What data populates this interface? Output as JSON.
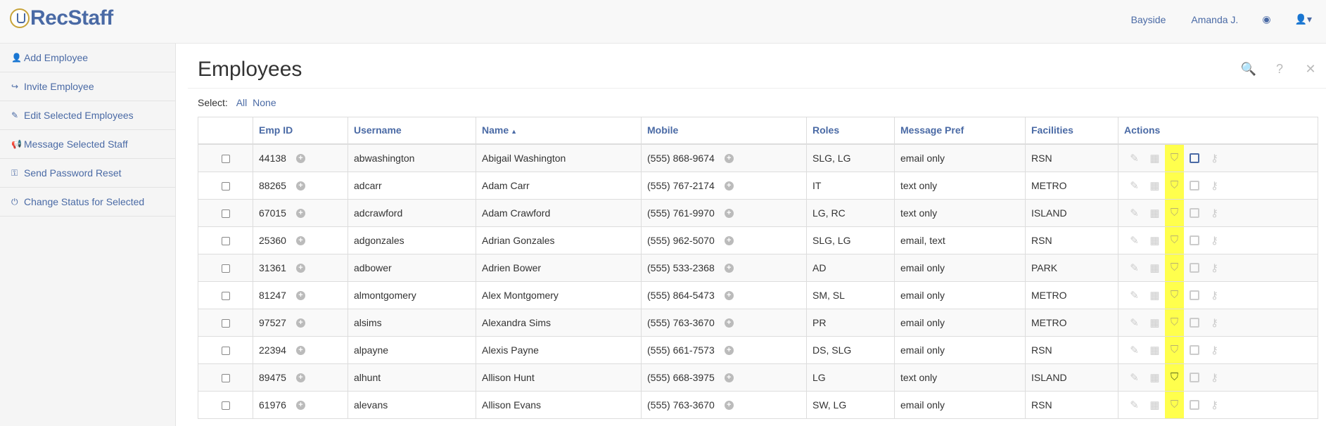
{
  "app": {
    "logo_text": "RecStaff"
  },
  "topnav": {
    "location": "Bayside",
    "user": "Amanda J."
  },
  "sidebar": {
    "items": [
      {
        "label": "Add Employee",
        "icon": "add-user-icon"
      },
      {
        "label": "Invite Employee",
        "icon": "invite-icon"
      },
      {
        "label": "Edit Selected Employees",
        "icon": "edit-icon"
      },
      {
        "label": "Message Selected Staff",
        "icon": "megaphone-icon"
      },
      {
        "label": "Send Password Reset",
        "icon": "key-icon"
      },
      {
        "label": "Change Status for Selected",
        "icon": "power-icon"
      }
    ]
  },
  "page": {
    "title": "Employees",
    "select_label": "Select:",
    "select_all": "All",
    "select_none": "None"
  },
  "table": {
    "columns": [
      "Emp ID",
      "Username",
      "Name",
      "Mobile",
      "Roles",
      "Message Pref",
      "Facilities",
      "Actions"
    ],
    "rows": [
      {
        "emp_id": "44138",
        "username": "abwashington",
        "name": "Abigail Washington",
        "mobile": "(555) 868-9674",
        "roles": "SLG, LG",
        "msg": "email only",
        "facility": "RSN"
      },
      {
        "emp_id": "88265",
        "username": "adcarr",
        "name": "Adam Carr",
        "mobile": "(555) 767-2174",
        "roles": "IT",
        "msg": "text only",
        "facility": "METRO"
      },
      {
        "emp_id": "67015",
        "username": "adcrawford",
        "name": "Adam Crawford",
        "mobile": "(555) 761-9970",
        "roles": "LG, RC",
        "msg": "text only",
        "facility": "ISLAND"
      },
      {
        "emp_id": "25360",
        "username": "adgonzales",
        "name": "Adrian Gonzales",
        "mobile": "(555) 962-5070",
        "roles": "SLG, LG",
        "msg": "email, text",
        "facility": "RSN"
      },
      {
        "emp_id": "31361",
        "username": "adbower",
        "name": "Adrien Bower",
        "mobile": "(555) 533-2368",
        "roles": "AD",
        "msg": "email only",
        "facility": "PARK"
      },
      {
        "emp_id": "81247",
        "username": "almontgomery",
        "name": "Alex Montgomery",
        "mobile": "(555) 864-5473",
        "roles": "SM, SL",
        "msg": "email only",
        "facility": "METRO"
      },
      {
        "emp_id": "97527",
        "username": "alsims",
        "name": "Alexandra Sims",
        "mobile": "(555) 763-3670",
        "roles": "PR",
        "msg": "email only",
        "facility": "METRO"
      },
      {
        "emp_id": "22394",
        "username": "alpayne",
        "name": "Alexis Payne",
        "mobile": "(555) 661-7573",
        "roles": "DS, SLG",
        "msg": "email only",
        "facility": "RSN"
      },
      {
        "emp_id": "89475",
        "username": "alhunt",
        "name": "Allison Hunt",
        "mobile": "(555) 668-3975",
        "roles": "LG",
        "msg": "text only",
        "facility": "ISLAND"
      },
      {
        "emp_id": "61976",
        "username": "alevans",
        "name": "Allison Evans",
        "mobile": "(555) 763-3670",
        "roles": "SW, LG",
        "msg": "email only",
        "facility": "RSN"
      }
    ]
  },
  "colors": {
    "link": "#4a6aa5",
    "highlight": "#ffff4d"
  }
}
